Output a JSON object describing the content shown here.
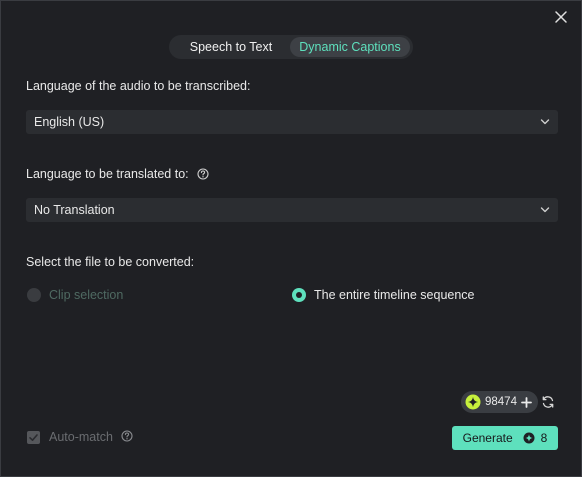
{
  "tabs": [
    {
      "label": "Speech to Text",
      "active": false
    },
    {
      "label": "Dynamic Captions",
      "active": true
    }
  ],
  "source_language": {
    "label": "Language of the audio to be transcribed:",
    "selected": "English (US)"
  },
  "target_language": {
    "label": "Language to be translated to:",
    "selected": "No Translation"
  },
  "file_selection": {
    "label": "Select the file to be converted:",
    "options": [
      {
        "label": "Clip selection",
        "selected": false,
        "disabled": true
      },
      {
        "label": "The entire timeline sequence",
        "selected": true,
        "disabled": false
      }
    ]
  },
  "credits": {
    "value": "98474"
  },
  "auto_match": {
    "label": "Auto-match",
    "checked": true,
    "disabled": true
  },
  "generate": {
    "label": "Generate",
    "cost": "8"
  },
  "colors": {
    "accent": "#5ee0bd",
    "background": "#1f2024",
    "field": "#2b2d31"
  },
  "icons": [
    "close-icon",
    "help-icon",
    "chevron-down-icon",
    "ai-credit-icon",
    "plus-icon",
    "refresh-icon",
    "checkmark-icon",
    "coin-icon"
  ]
}
